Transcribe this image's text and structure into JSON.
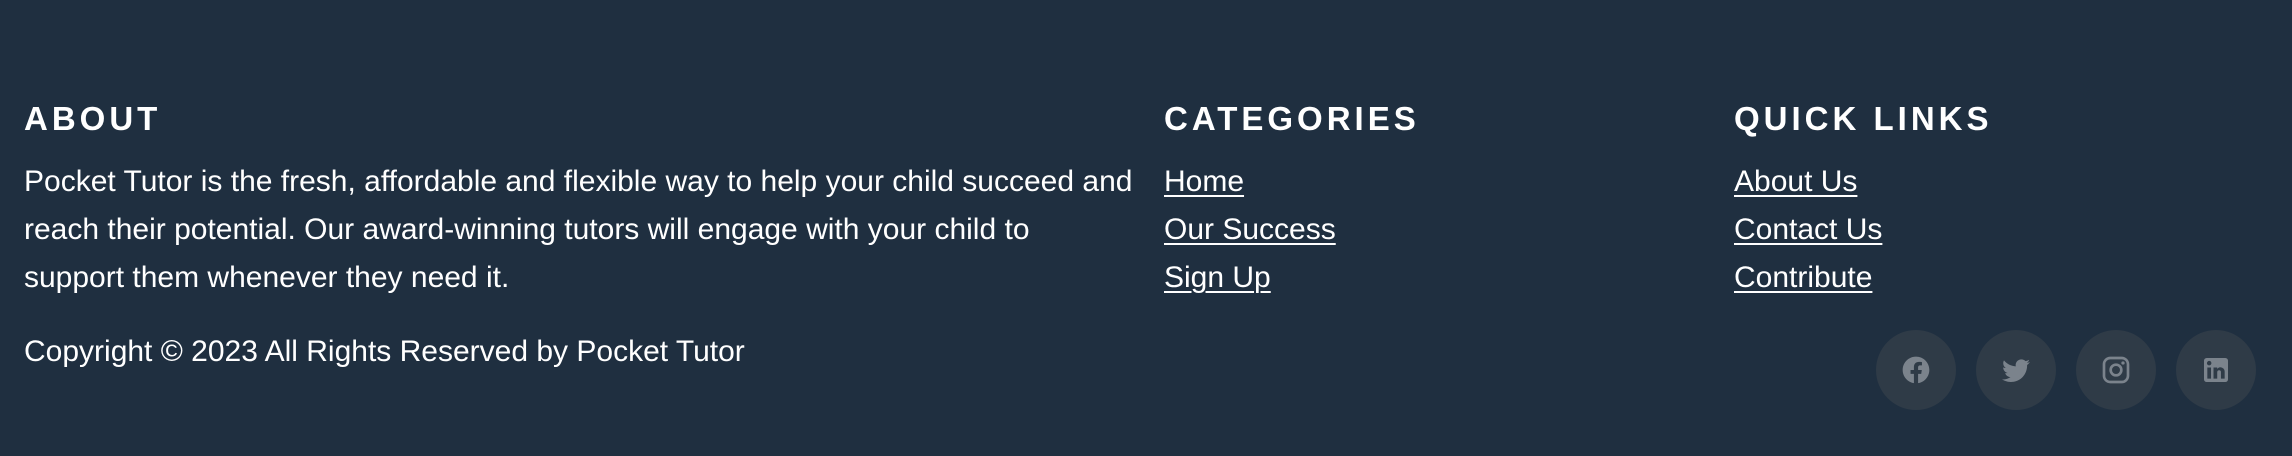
{
  "about": {
    "heading": "ABOUT",
    "text": "Pocket Tutor is the fresh, affordable and flexible way to help your child succeed and reach their potential. Our award-winning tutors will engage with your child to support them whenever they need it."
  },
  "categories": {
    "heading": "CATEGORIES",
    "links": [
      "Home",
      "Our Success",
      "Sign Up"
    ]
  },
  "quick_links": {
    "heading": "QUICK LINKS",
    "links": [
      "About Us",
      "Contact Us",
      "Contribute"
    ]
  },
  "copyright": "Copyright © 2023 All Rights Reserved by Pocket Tutor",
  "social_icons": [
    "facebook-icon",
    "twitter-icon",
    "instagram-icon",
    "linkedin-icon"
  ],
  "colors": {
    "background": "#1f2f40",
    "text": "#ffffff",
    "social_bg": "#2f3b47",
    "social_icon": "#7b838c"
  }
}
